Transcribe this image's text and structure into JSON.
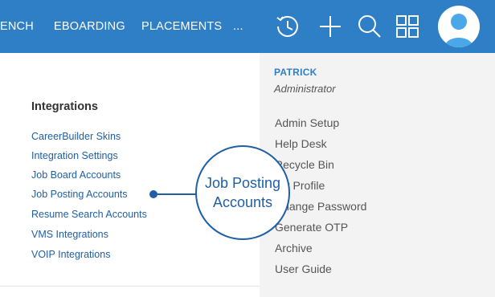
{
  "nav": {
    "links": [
      "ENCH",
      "EBOARDING",
      "PLACEMENTS",
      "..."
    ]
  },
  "icons": [
    "history-icon",
    "plus-icon",
    "search-icon",
    "grid-icon",
    "avatar-icon"
  ],
  "colors": {
    "topbar": "#2f7fc7",
    "link": "#1f5fa5",
    "panel": "#f3f3f3"
  },
  "user_menu": {
    "name": "PATRICK",
    "role": "Administrator",
    "items": [
      "Admin Setup",
      "Help Desk",
      "Recycle Bin",
      "My Profile",
      "Change Password",
      "Generate OTP",
      "Archive",
      "User Guide"
    ]
  },
  "integrations": {
    "title": "Integrations",
    "links": [
      "CareerBuilder Skins",
      "Integration Settings",
      "Job Board Accounts",
      "Job Posting Accounts",
      "Resume Search Accounts",
      "VMS Integrations",
      "VOIP Integrations"
    ]
  },
  "callout": {
    "label": "Job Posting Accounts"
  }
}
